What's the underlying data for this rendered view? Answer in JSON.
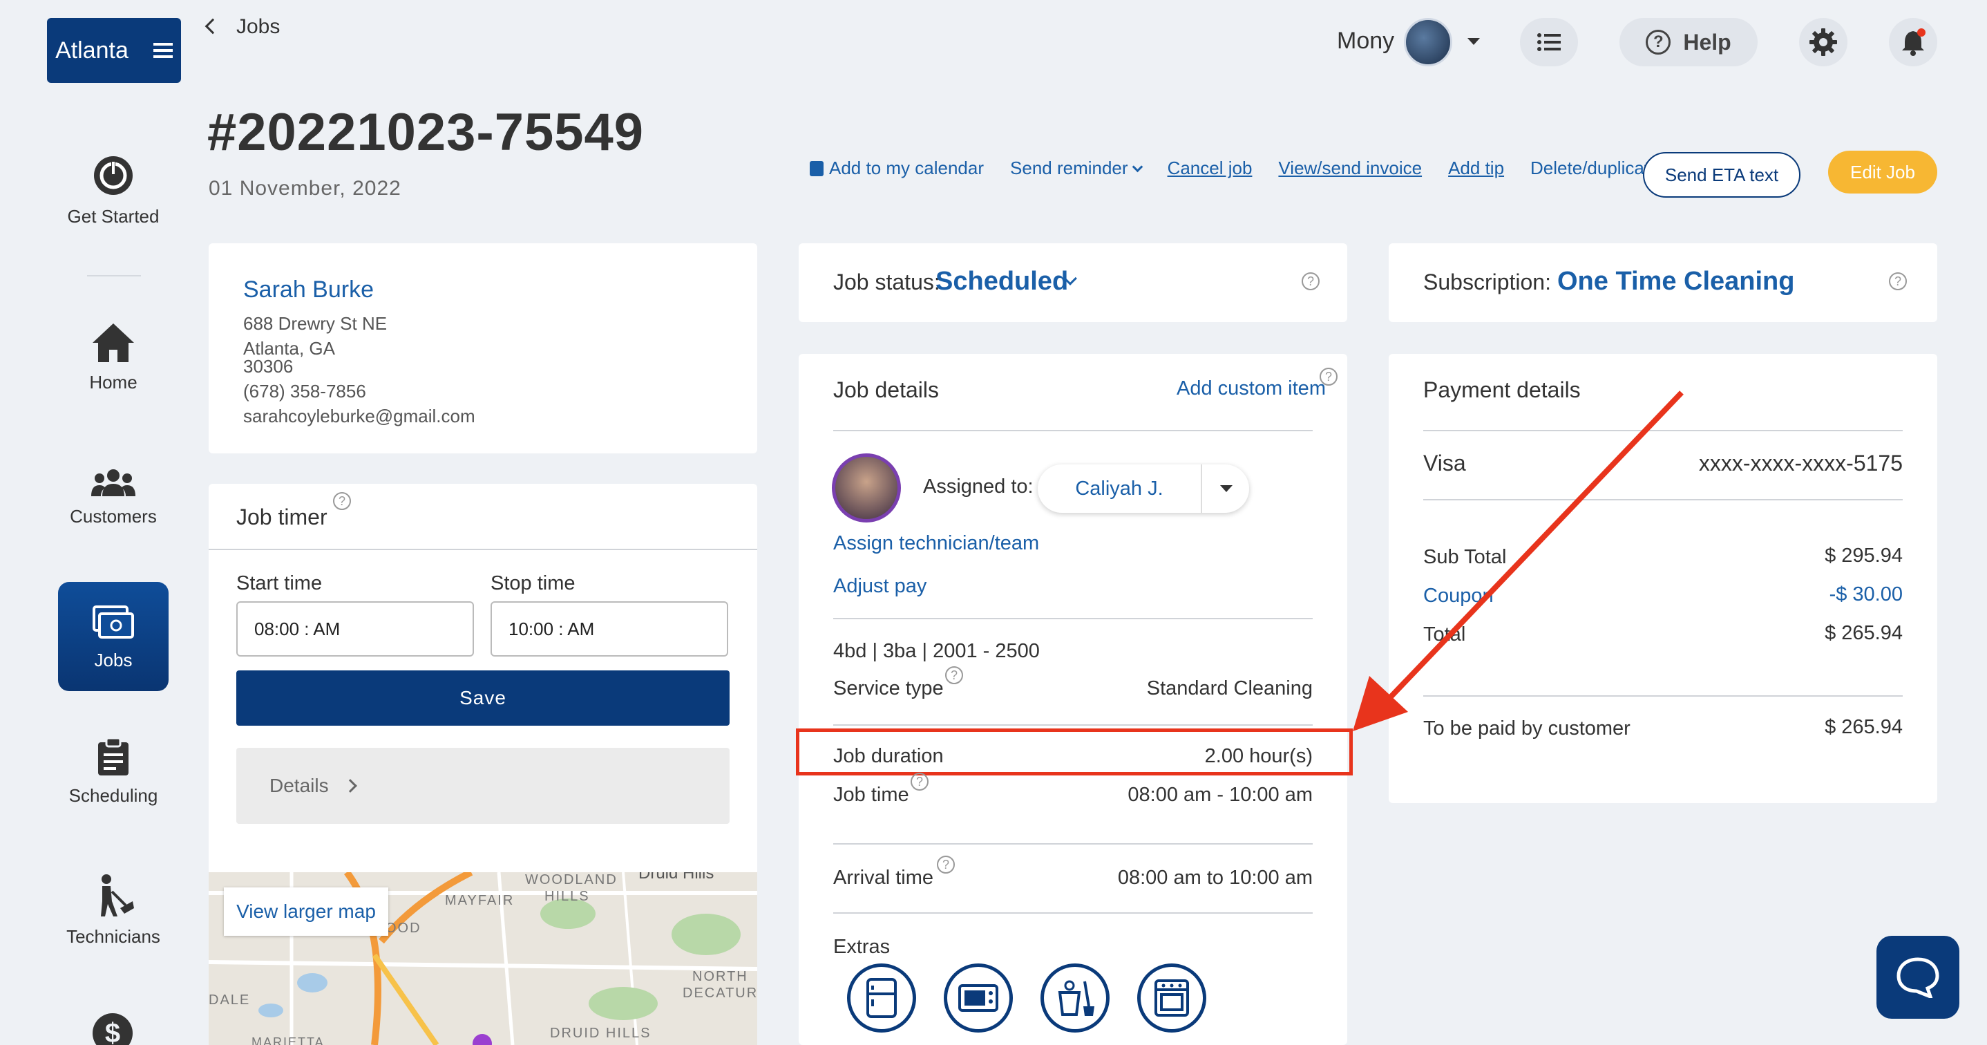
{
  "sidebar": {
    "brand": "Atlanta",
    "items": [
      {
        "label": "Get Started",
        "icon": "power-icon"
      },
      {
        "label": "Home",
        "icon": "home-icon"
      },
      {
        "label": "Customers",
        "icon": "people-icon"
      },
      {
        "label": "Jobs",
        "icon": "jobs-icon"
      },
      {
        "label": "Scheduling",
        "icon": "clipboard-icon"
      },
      {
        "label": "Technicians",
        "icon": "technician-icon"
      }
    ]
  },
  "header": {
    "back_label": "Jobs",
    "user_name": "Mony",
    "help_label": "Help"
  },
  "job": {
    "number": "#20221023-75549",
    "date": "01 November, 2022"
  },
  "actions": {
    "calendar": "Add to my calendar",
    "reminder": "Send reminder",
    "cancel": "Cancel job",
    "invoice": "View/send invoice",
    "tip": "Add tip",
    "delete": "Delete/duplicate",
    "eta": "Send ETA text",
    "edit": "Edit Job"
  },
  "customer": {
    "name": "Sarah Burke",
    "street": "688 Drewry St NE",
    "city": "Atlanta, GA",
    "zip": "30306",
    "phone": "(678) 358-7856",
    "email": "sarahcoyleburke@gmail.com"
  },
  "timer": {
    "title": "Job timer",
    "start_label": "Start time",
    "stop_label": "Stop time",
    "start_value": "08:00 : AM",
    "stop_value": "10:00 : AM",
    "save": "Save",
    "details": "Details"
  },
  "map": {
    "button": "View larger map",
    "labels": [
      "WOODLAND",
      "HILLS",
      "MAYFAIR",
      "OOD",
      "NORTH",
      "DECATUR",
      "DALE",
      "DRUID HILLS",
      "MARIETTA",
      "Druid Hills"
    ]
  },
  "status": {
    "label": "Job status:",
    "value": "Scheduled"
  },
  "details": {
    "title": "Job details",
    "add_custom": "Add custom item",
    "assigned_label": "Assigned to:",
    "assigned_value": "Caliyah J.",
    "assign_link": "Assign technician/team",
    "adjust_pay": "Adjust pay",
    "home_size": "4bd | 3ba | 2001 - 2500",
    "service_type_label": "Service type",
    "service_type_value": "Standard Cleaning",
    "duration_label": "Job duration",
    "duration_value": "2.00 hour(s)",
    "job_time_label": "Job time",
    "job_time_value": "08:00 am - 10:00 am",
    "arrival_label": "Arrival time",
    "arrival_value": "08:00 am to 10:00 am",
    "extras_label": "Extras"
  },
  "subscription": {
    "label": "Subscription:",
    "value": "One Time Cleaning"
  },
  "payment": {
    "title": "Payment details",
    "card_type": "Visa",
    "card_number": "xxxx-xxxx-xxxx-5175",
    "subtotal_label": "Sub Total",
    "subtotal_value": "$ 295.94",
    "coupon_label": "Coupon",
    "coupon_value": "-$ 30.00",
    "total_label": "Total",
    "total_value": "$ 265.94",
    "to_pay_label": "To be paid by customer",
    "to_pay_value": "$ 265.94"
  },
  "colors": {
    "brand": "#0a3a7a",
    "link": "#1a5fa8",
    "accent": "#f7b733",
    "annotation": "#e8341c"
  }
}
